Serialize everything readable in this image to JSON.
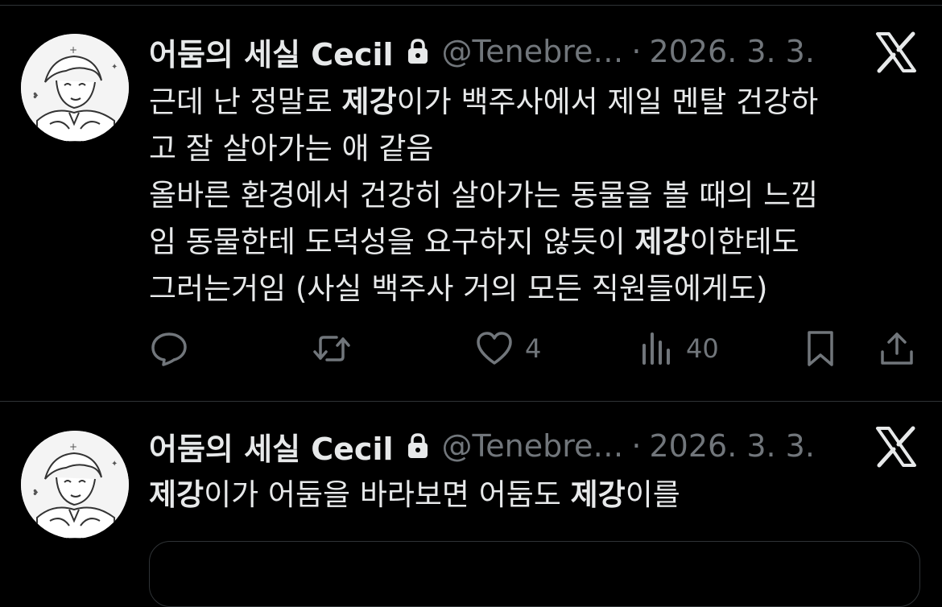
{
  "tweets": [
    {
      "author": {
        "display_name": "어둠의 세실 Cecil",
        "handle": "@Tenebre…",
        "protected_icon": "lock-icon"
      },
      "separator": "·",
      "date": "2026. 3. 3.",
      "source_icon": "x-logo-icon",
      "lines": [
        [
          "근데 난 정말로 ",
          "제강",
          "이가 백주사에서 제일 멘탈 건강하"
        ],
        [
          "고 잘 살아가는 애 같음",
          "",
          ""
        ],
        [
          "올바른 환경에서 건강히 살아가는 동물을 볼 때의 느낌",
          "",
          ""
        ],
        [
          "임 동물한테 도덕성을 요구하지 않듯이 ",
          "제강",
          "이한테도"
        ],
        [
          "그러는거임 (사실 백주사 거의 모든 직원들에게도)",
          "",
          ""
        ]
      ],
      "actions": {
        "reply_icon": "reply-icon",
        "retweet_icon": "retweet-icon",
        "like_icon": "heart-icon",
        "like_count": "4",
        "views_icon": "views-bar-chart-icon",
        "views_count": "40",
        "bookmark_icon": "bookmark-icon",
        "share_icon": "share-icon"
      }
    },
    {
      "author": {
        "display_name": "어둠의 세실 Cecil",
        "handle": "@Tenebre…",
        "protected_icon": "lock-icon"
      },
      "separator": "·",
      "date": "2026. 3. 3.",
      "source_icon": "x-logo-icon",
      "lines": [
        [
          "",
          "제강",
          "이가 어둠을 바라보면 어둠도 "
        ],
        [
          "",
          "제강",
          "이를"
        ]
      ]
    }
  ],
  "colors": {
    "background": "#000000",
    "text": "#e7e9ea",
    "secondary": "#71767b",
    "border": "#2f3336"
  }
}
